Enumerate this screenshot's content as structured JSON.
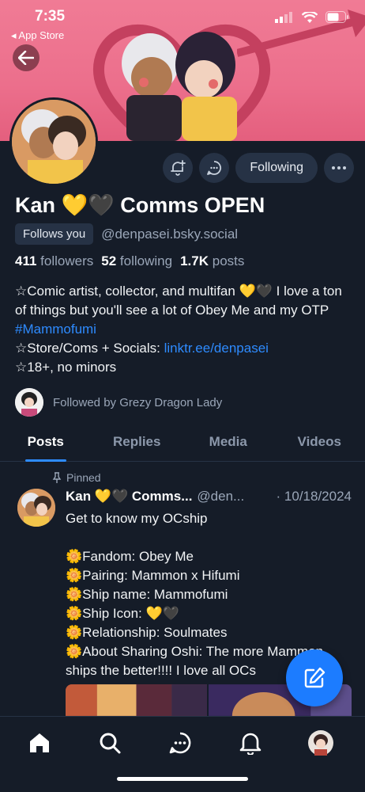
{
  "status_bar": {
    "time": "7:35",
    "back_app": "◂ App Store"
  },
  "profile": {
    "display_name": "Kan 💛🖤 Comms OPEN",
    "follows_you_badge": "Follows you",
    "handle": "@denpasei.bsky.social",
    "followers_count": "411",
    "followers_label": "followers",
    "following_count": "52",
    "following_label": "following",
    "posts_count": "1.7K",
    "posts_label": "posts",
    "bio_line1": "☆Comic artist, collector, and multifan 💛🖤 I love a ton of things but you'll see a lot of Obey Me and my OTP ",
    "bio_hashtag": "#Mammofumi",
    "bio_line2": "☆Store/Coms + Socials: ",
    "bio_link": "linktr.ee/denpasei",
    "bio_line3": "☆18+, no minors",
    "followed_by": "Followed by Grezy Dragon Lady"
  },
  "actions": {
    "following_label": "Following"
  },
  "tabs": [
    {
      "label": "Posts"
    },
    {
      "label": "Replies"
    },
    {
      "label": "Media"
    },
    {
      "label": "Videos"
    }
  ],
  "post": {
    "pinned_label": "Pinned",
    "author_name": "Kan 💛🖤 Comms...",
    "author_handle": "@den...",
    "date": "· 10/18/2024",
    "lines": [
      "Get to know my OCship",
      "",
      "🌼Fandom: Obey Me",
      "🌼Pairing: Mammon x Hifumi",
      "🌼Ship name: Mammofumi",
      "🌼Ship Icon: 💛🖤",
      "🌼Relationship: Soulmates",
      "🌼About Sharing Oshi: The more Mammon ships the better!!!! I love all OCs"
    ]
  },
  "colors": {
    "accent": "#2e8bff",
    "background": "#151c28",
    "banner": "#ec6f8c"
  }
}
